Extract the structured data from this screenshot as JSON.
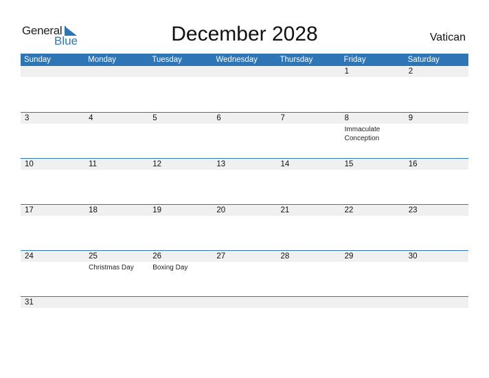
{
  "brand": {
    "word1": "General",
    "word2": "Blue"
  },
  "title": "December 2028",
  "country": "Vatican",
  "colors": {
    "accent": "#2e75b6",
    "strip": "#f0f0f0"
  },
  "weekdays": [
    "Sunday",
    "Monday",
    "Tuesday",
    "Wednesday",
    "Thursday",
    "Friday",
    "Saturday"
  ],
  "weeks": [
    [
      {
        "day": "",
        "holiday": ""
      },
      {
        "day": "",
        "holiday": ""
      },
      {
        "day": "",
        "holiday": ""
      },
      {
        "day": "",
        "holiday": ""
      },
      {
        "day": "",
        "holiday": ""
      },
      {
        "day": "1",
        "holiday": ""
      },
      {
        "day": "2",
        "holiday": ""
      }
    ],
    [
      {
        "day": "3",
        "holiday": ""
      },
      {
        "day": "4",
        "holiday": ""
      },
      {
        "day": "5",
        "holiday": ""
      },
      {
        "day": "6",
        "holiday": ""
      },
      {
        "day": "7",
        "holiday": ""
      },
      {
        "day": "8",
        "holiday": "Immaculate Conception"
      },
      {
        "day": "9",
        "holiday": ""
      }
    ],
    [
      {
        "day": "10",
        "holiday": ""
      },
      {
        "day": "11",
        "holiday": ""
      },
      {
        "day": "12",
        "holiday": ""
      },
      {
        "day": "13",
        "holiday": ""
      },
      {
        "day": "14",
        "holiday": ""
      },
      {
        "day": "15",
        "holiday": ""
      },
      {
        "day": "16",
        "holiday": ""
      }
    ],
    [
      {
        "day": "17",
        "holiday": ""
      },
      {
        "day": "18",
        "holiday": ""
      },
      {
        "day": "19",
        "holiday": ""
      },
      {
        "day": "20",
        "holiday": ""
      },
      {
        "day": "21",
        "holiday": ""
      },
      {
        "day": "22",
        "holiday": ""
      },
      {
        "day": "23",
        "holiday": ""
      }
    ],
    [
      {
        "day": "24",
        "holiday": ""
      },
      {
        "day": "25",
        "holiday": "Christmas Day"
      },
      {
        "day": "26",
        "holiday": "Boxing Day"
      },
      {
        "day": "27",
        "holiday": ""
      },
      {
        "day": "28",
        "holiday": ""
      },
      {
        "day": "29",
        "holiday": ""
      },
      {
        "day": "30",
        "holiday": ""
      }
    ],
    [
      {
        "day": "31",
        "holiday": ""
      },
      {
        "day": "",
        "holiday": ""
      },
      {
        "day": "",
        "holiday": ""
      },
      {
        "day": "",
        "holiday": ""
      },
      {
        "day": "",
        "holiday": ""
      },
      {
        "day": "",
        "holiday": ""
      },
      {
        "day": "",
        "holiday": ""
      }
    ]
  ]
}
